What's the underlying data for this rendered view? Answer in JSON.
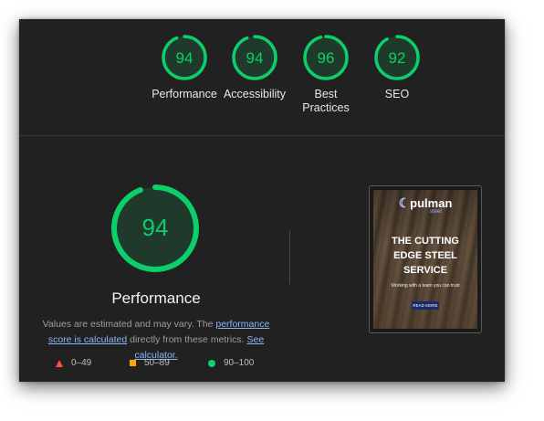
{
  "scores": [
    {
      "value": "94",
      "label": "Performance",
      "fraction": 0.94
    },
    {
      "value": "94",
      "label": "Accessibility",
      "fraction": 0.94
    },
    {
      "value": "96",
      "label": "Best Practices",
      "fraction": 0.96
    },
    {
      "value": "92",
      "label": "SEO",
      "fraction": 0.92
    }
  ],
  "main": {
    "score": "94",
    "fraction": 0.94,
    "title": "Performance",
    "desc_prefix": "Values are estimated and may vary. The ",
    "perf_link": "performance score is calculated",
    "desc_mid": " directly from these metrics. ",
    "calc_link": "See calculator."
  },
  "legend": {
    "low": "0–49",
    "mid": "50–89",
    "high": "90–100"
  },
  "thumbnail": {
    "logo": "pulman",
    "logo_sub": "steel",
    "headline_line1": "THE CUTTING",
    "headline_line2": "EDGE STEEL",
    "headline_line3": "SERVICE",
    "tagline": "Working with a team you can trust",
    "button": "READ MORE"
  },
  "colors": {
    "pass": "#0cce6b",
    "average": "#ffa400",
    "fail": "#ff4e42",
    "link": "#8ab4f8",
    "background": "#212121"
  }
}
